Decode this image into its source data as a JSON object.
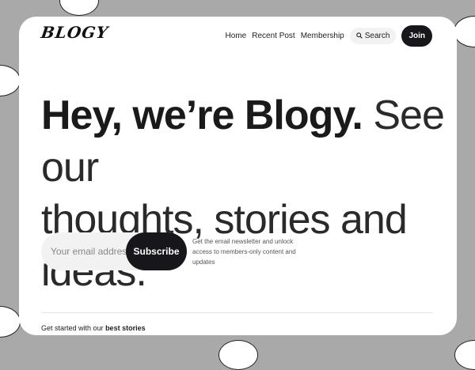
{
  "brand": {
    "logo_text": "BLOGY"
  },
  "nav": {
    "links": [
      "Home",
      "Recent Post",
      "Membership"
    ],
    "search_label": "Search",
    "join_label": "Join"
  },
  "hero": {
    "headline_bold": "Hey, we’re Blogy.",
    "headline_light_1": "See our",
    "headline_light_2": "thoughts, stories and ideas."
  },
  "subscribe": {
    "email_placeholder": "Your email address",
    "button_label": "Subscribe",
    "note": "Get the email newsletter and unlock access to members-only content and updates"
  },
  "best_stories": {
    "prefix": "Get started with our",
    "emphasis": "best stories"
  },
  "colors": {
    "backdrop": "#a9a9a9",
    "card": "#ffffff",
    "dark_button": "#17171b",
    "input_bg": "#f2f2f3"
  },
  "icons": {
    "search": "search-icon"
  }
}
